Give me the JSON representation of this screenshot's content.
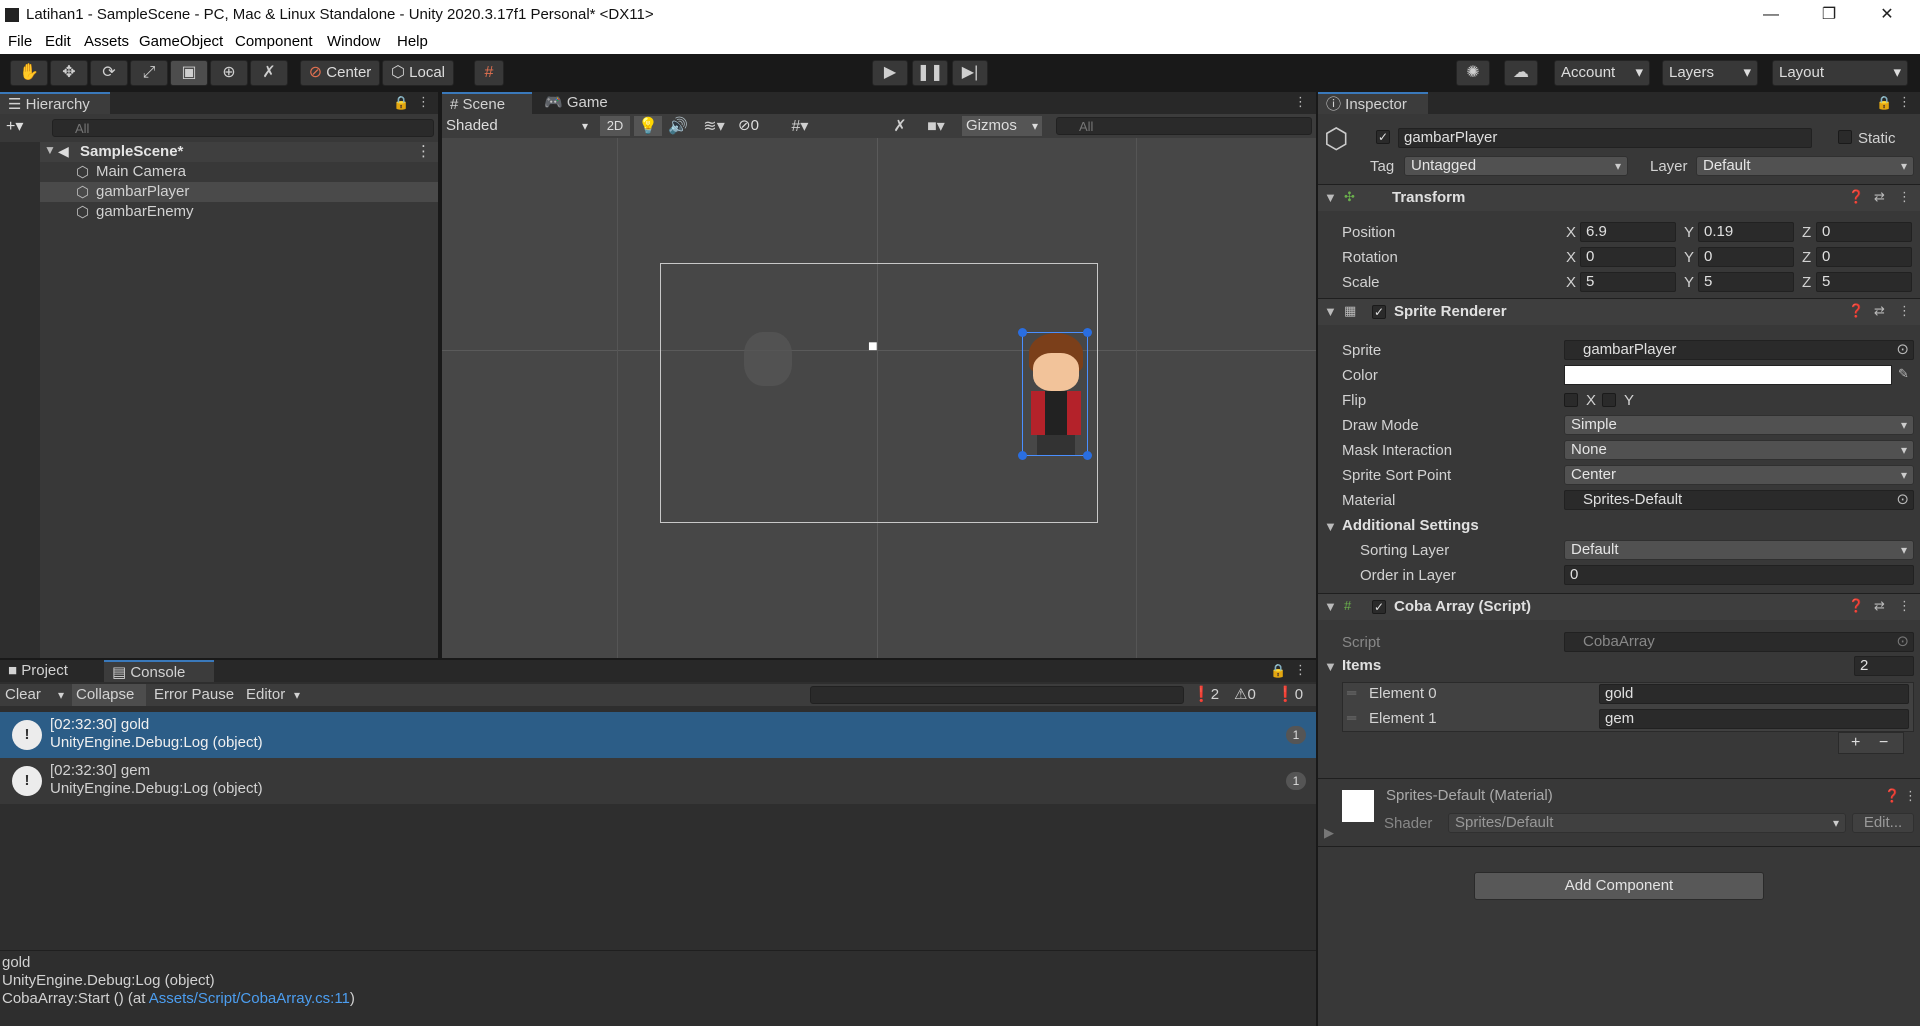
{
  "window": {
    "title": "Latihan1 - SampleScene - PC, Mac & Linux Standalone - Unity 2020.3.17f1 Personal* <DX11>",
    "minimize": "—",
    "maximize": "❐",
    "close": "✕"
  },
  "menu": [
    "File",
    "Edit",
    "Assets",
    "GameObject",
    "Component",
    "Window",
    "Help"
  ],
  "toolbar": {
    "center": "Center",
    "local": "Local",
    "account": "Account",
    "layers": "Layers",
    "layout": "Layout"
  },
  "hierarchy": {
    "tab": "Hierarchy",
    "search_placeholder": "All",
    "scene": "SampleScene*",
    "items": [
      "Main Camera",
      "gambarPlayer",
      "gambarEnemy"
    ]
  },
  "scene": {
    "tabs": [
      "Scene",
      "Game"
    ],
    "shading": "Shaded",
    "mode2d": "2D",
    "hidden_count": "0",
    "gizmos": "Gizmos",
    "search_placeholder": "All"
  },
  "console": {
    "tabs": [
      "Project",
      "Console"
    ],
    "clear": "Clear",
    "collapse": "Collapse",
    "error_pause": "Error Pause",
    "editor": "Editor",
    "counts": {
      "logs": "2",
      "warnings": "0",
      "errors": "0"
    },
    "entries": [
      {
        "line1": "[02:32:30] gold",
        "line2": "UnityEngine.Debug:Log (object)",
        "count": "1"
      },
      {
        "line1": "[02:32:30] gem",
        "line2": "UnityEngine.Debug:Log (object)",
        "count": "1"
      }
    ],
    "detail": {
      "line1": "gold",
      "line2": "UnityEngine.Debug:Log (object)",
      "line3_prefix": "CobaArray:Start () (at ",
      "line3_link": "Assets/Script/CobaArray.cs:11",
      "line3_suffix": ")"
    }
  },
  "inspector": {
    "tab": "Inspector",
    "object_name": "gambarPlayer",
    "static_label": "Static",
    "tag_label": "Tag",
    "tag": "Untagged",
    "layer_label": "Layer",
    "layer": "Default",
    "transform": {
      "title": "Transform",
      "rows": [
        {
          "label": "Position",
          "x": "6.9",
          "y": "0.19",
          "z": "0"
        },
        {
          "label": "Rotation",
          "x": "0",
          "y": "0",
          "z": "0"
        },
        {
          "label": "Scale",
          "x": "5",
          "y": "5",
          "z": "5"
        }
      ],
      "axis": {
        "x": "X",
        "y": "Y",
        "z": "Z"
      }
    },
    "sprite_renderer": {
      "title": "Sprite Renderer",
      "sprite_label": "Sprite",
      "sprite": "gambarPlayer",
      "color_label": "Color",
      "flip_label": "Flip",
      "flip_x": "X",
      "flip_y": "Y",
      "draw_mode_label": "Draw Mode",
      "draw_mode": "Simple",
      "mask_label": "Mask Interaction",
      "mask": "None",
      "sort_point_label": "Sprite Sort Point",
      "sort_point": "Center",
      "material_label": "Material",
      "material": "Sprites-Default",
      "additional": "Additional Settings",
      "sorting_layer_label": "Sorting Layer",
      "sorting_layer": "Default",
      "order_label": "Order in Layer",
      "order": "0"
    },
    "script": {
      "title": "Coba Array (Script)",
      "script_label": "Script",
      "script": "CobaArray",
      "items_label": "Items",
      "items_count": "2",
      "elements": [
        {
          "label": "Element 0",
          "value": "gold"
        },
        {
          "label": "Element 1",
          "value": "gem"
        }
      ],
      "plus": "+",
      "minus": "−"
    },
    "material": {
      "title": "Sprites-Default (Material)",
      "shader_label": "Shader",
      "shader": "Sprites/Default",
      "edit": "Edit..."
    },
    "add_component": "Add Component"
  }
}
